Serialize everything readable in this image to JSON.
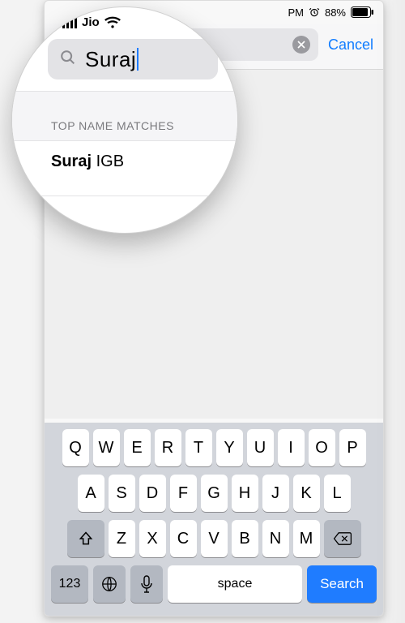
{
  "status": {
    "carrier": "Jio",
    "time_suffix": "PM",
    "battery_pct": "88%"
  },
  "search": {
    "query": "Suraj",
    "cancel_label": "Cancel"
  },
  "results": {
    "section_title": "TOP NAME MATCHES",
    "first_match_bold": "Suraj",
    "first_match_rest": " IGB"
  },
  "keyboard": {
    "row1": [
      "Q",
      "W",
      "E",
      "R",
      "T",
      "Y",
      "U",
      "I",
      "O",
      "P"
    ],
    "row2": [
      "A",
      "S",
      "D",
      "F",
      "G",
      "H",
      "J",
      "K",
      "L"
    ],
    "row3": [
      "Z",
      "X",
      "C",
      "V",
      "B",
      "N",
      "M"
    ],
    "numbers_label": "123",
    "space_label": "space",
    "search_label": "Search"
  }
}
